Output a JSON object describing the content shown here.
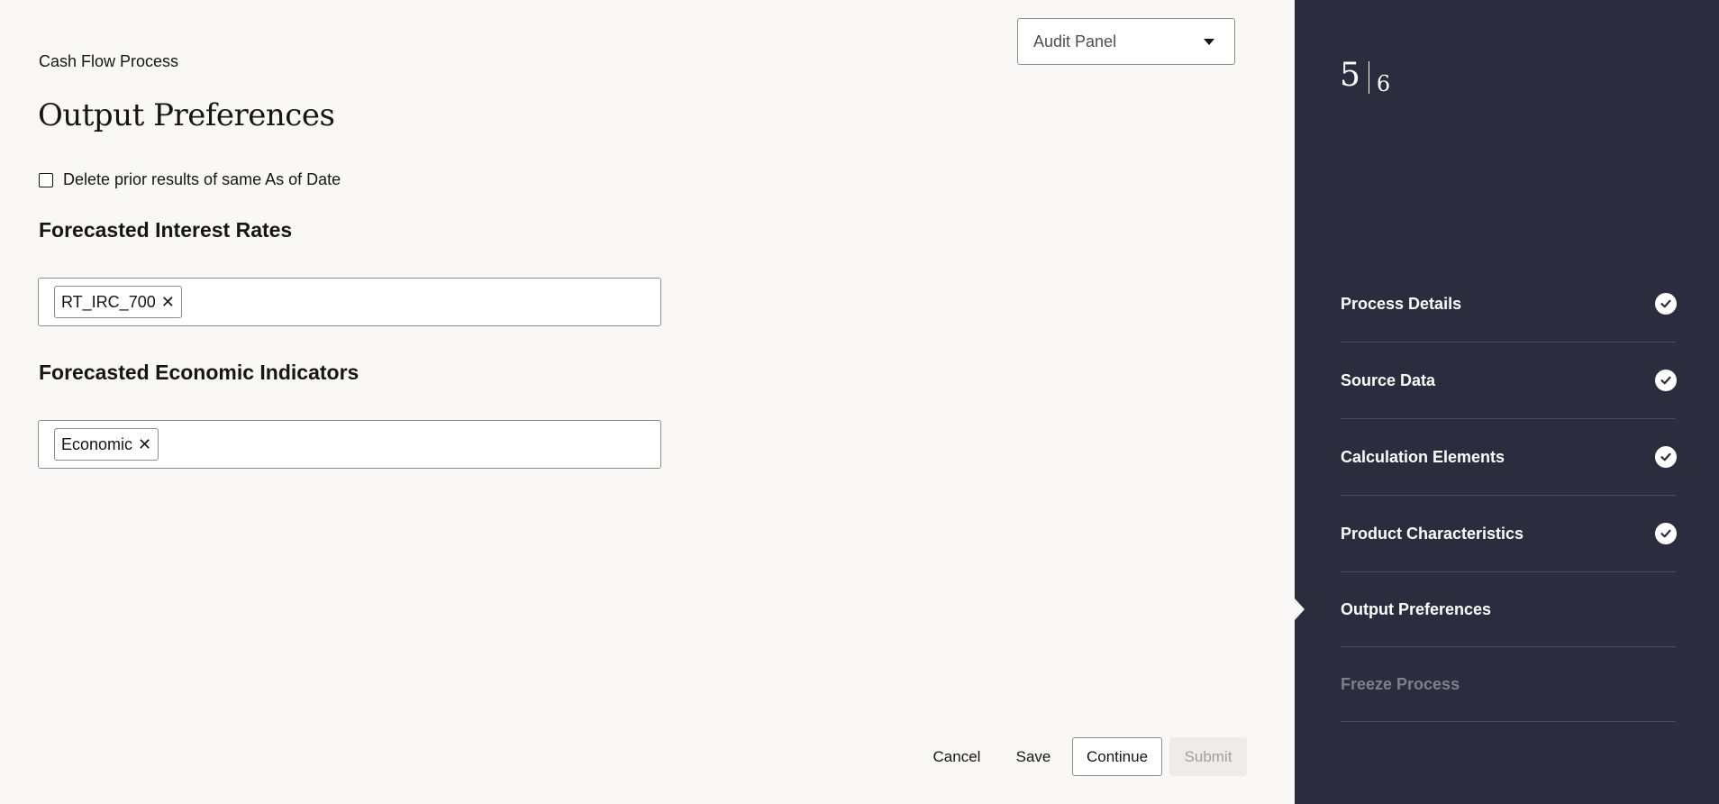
{
  "breadcrumb": "Cash Flow Process",
  "title": "Output Preferences",
  "audit_panel": {
    "selected": "Audit Panel"
  },
  "delete_prior": {
    "label": "Delete prior results of same As of Date",
    "checked": false
  },
  "sections": {
    "interest_rates": {
      "title": "Forecasted Interest Rates",
      "tags": [
        "RT_IRC_700"
      ]
    },
    "economic_indicators": {
      "title": "Forecasted Economic Indicators",
      "tags": [
        "Economic"
      ]
    }
  },
  "actions": {
    "cancel": "Cancel",
    "save": "Save",
    "continue": "Continue",
    "submit": "Submit"
  },
  "train": {
    "current": "5",
    "total": "6",
    "steps": [
      {
        "label": "Process Details",
        "state": "complete"
      },
      {
        "label": "Source Data",
        "state": "complete"
      },
      {
        "label": "Calculation Elements",
        "state": "complete"
      },
      {
        "label": "Product Characteristics",
        "state": "complete"
      },
      {
        "label": "Output Preferences",
        "state": "current"
      },
      {
        "label": "Freeze Process",
        "state": "disabled"
      }
    ]
  },
  "icons": {
    "remove": "close-icon",
    "dropdown": "caret-down-icon",
    "complete": "checkmark-icon"
  },
  "colors": {
    "sidebar_bg": "#2b2d3e",
    "page_bg": "#f9f8f6",
    "disabled_text": "#7d7f8b"
  }
}
